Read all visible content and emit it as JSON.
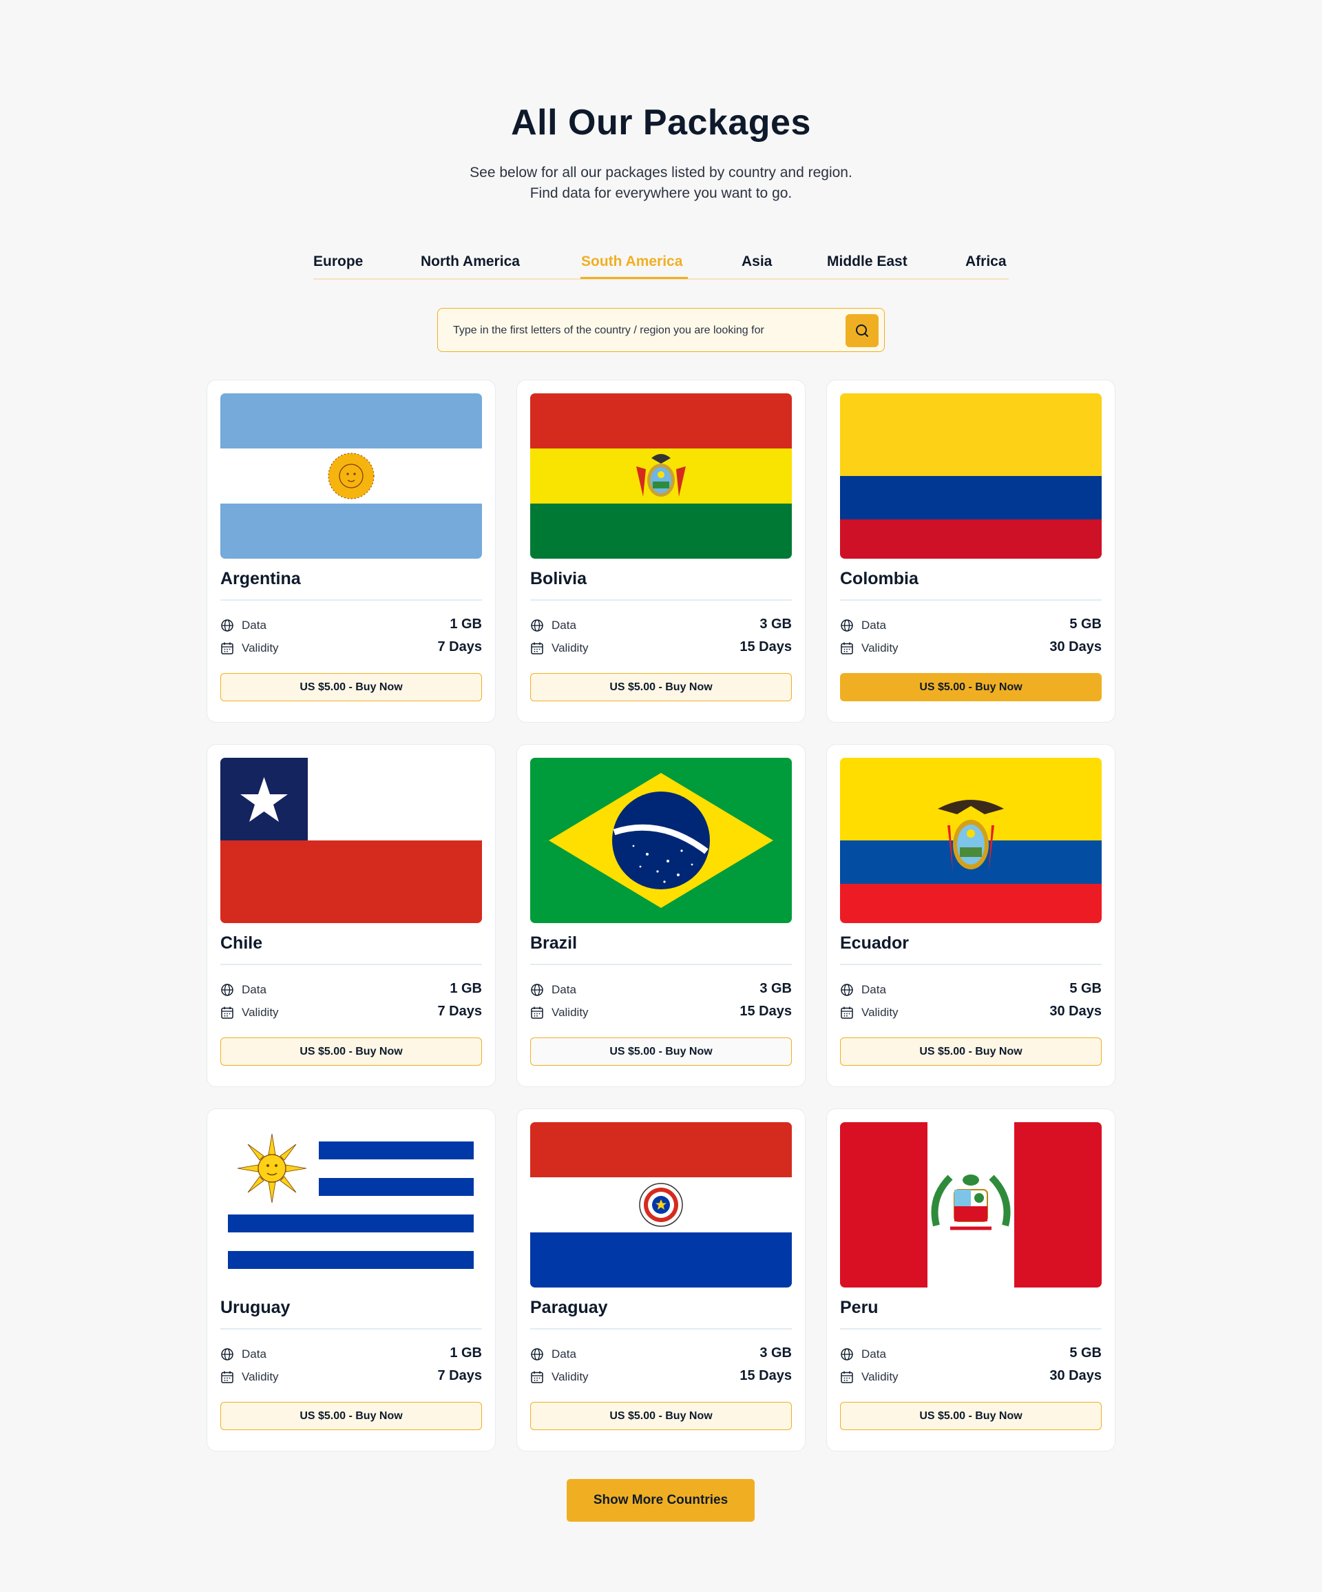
{
  "header": {
    "title": "All Our Packages",
    "subtitle_line1": "See below for all our packages listed by country and region.",
    "subtitle_line2": "Find data for everywhere you want to go."
  },
  "tabs": [
    {
      "label": "Europe",
      "active": false
    },
    {
      "label": "North America",
      "active": false
    },
    {
      "label": "South America",
      "active": true
    },
    {
      "label": "Asia",
      "active": false
    },
    {
      "label": "Middle East",
      "active": false
    },
    {
      "label": "Africa",
      "active": false
    }
  ],
  "search": {
    "placeholder": "Type in the first letters of the country / region you are looking for",
    "icon": "search-icon"
  },
  "labels": {
    "data": "Data",
    "validity": "Validity"
  },
  "cards": [
    {
      "country": "Argentina",
      "data": "1 GB",
      "validity": "7 Days",
      "button": "US $5.00 - Buy Now",
      "flag": "argentina-flag"
    },
    {
      "country": "Bolivia",
      "data": "3 GB",
      "validity": "15 Days",
      "button": "US $5.00 - Buy Now",
      "flag": "bolivia-flag"
    },
    {
      "country": "Colombia",
      "data": "5 GB",
      "validity": "30 Days",
      "button": "US $5.00 - Buy Now",
      "flag": "colombia-flag",
      "highlighted": true
    },
    {
      "country": "Chile",
      "data": "1 GB",
      "validity": "7 Days",
      "button": "US $5.00 - Buy Now",
      "flag": "chile-flag"
    },
    {
      "country": "Brazil",
      "data": "3 GB",
      "validity": "15 Days",
      "button": "US $5.00 - Buy Now",
      "flag": "brazil-flag"
    },
    {
      "country": "Ecuador",
      "data": "5 GB",
      "validity": "30 Days",
      "button": "US $5.00 - Buy Now",
      "flag": "ecuador-flag"
    },
    {
      "country": "Uruguay",
      "data": "1 GB",
      "validity": "7 Days",
      "button": "US $5.00 - Buy Now",
      "flag": "uruguay-flag"
    },
    {
      "country": "Paraguay",
      "data": "3 GB",
      "validity": "15 Days",
      "button": "US $5.00 - Buy Now",
      "flag": "paraguay-flag"
    },
    {
      "country": "Peru",
      "data": "5 GB",
      "validity": "30 Days",
      "button": "US $5.00 - Buy Now",
      "flag": "peru-flag"
    }
  ],
  "show_more": "Show More Countries",
  "colors": {
    "accent": "#f0af22",
    "text": "#0e1a2b",
    "background": "#f8f7f7"
  }
}
